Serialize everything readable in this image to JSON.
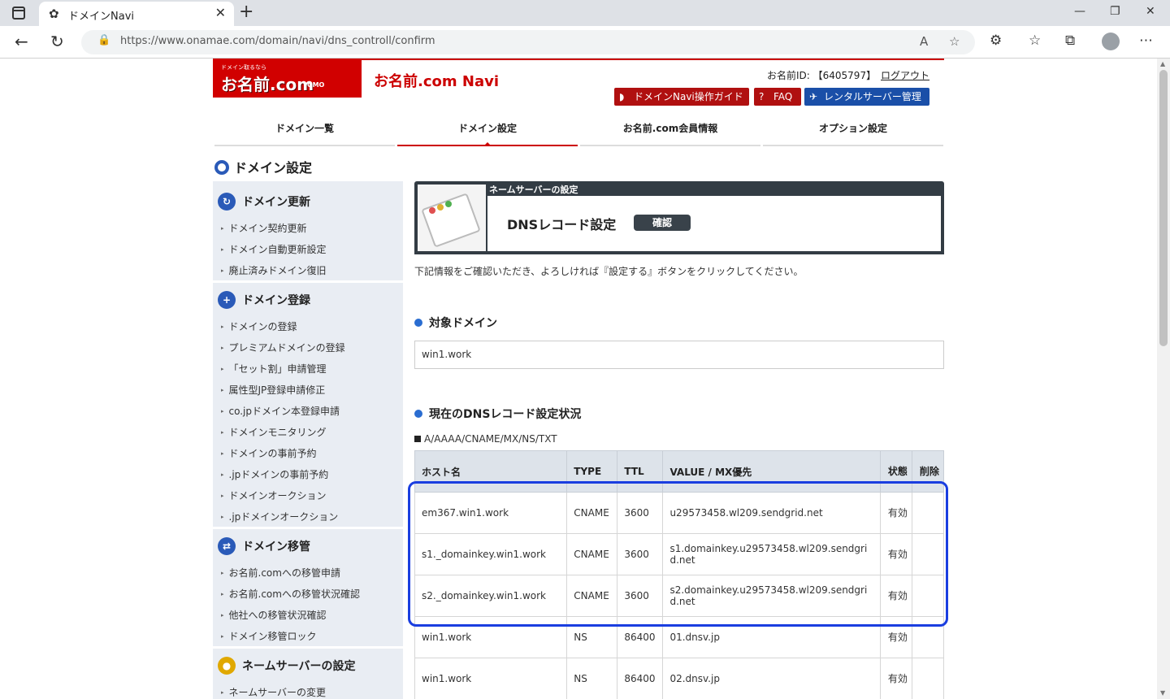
{
  "browser": {
    "tab_title": "ドメインNavi",
    "url": "https://www.onamae.com/domain/navi/dns_controll/confirm"
  },
  "header": {
    "logo_small": "ドメイン取るなら",
    "logo_main": "お名前.com",
    "logo_gmo": "GMO",
    "site_title": "お名前.com Navi",
    "user_id": "お名前ID: 【6405797】",
    "logout": "ログアウト",
    "buttons": [
      {
        "label": "ドメインNavi操作ガイド",
        "color": "#b01010"
      },
      {
        "label": "FAQ",
        "color": "#b01010"
      },
      {
        "label": "レンタルサーバー管理",
        "color": "#1a4fa8"
      }
    ]
  },
  "global_nav": [
    "ドメイン一覧",
    "ドメイン設定",
    "お名前.com会員情報",
    "オプション設定"
  ],
  "page_heading": "ドメイン設定",
  "sidebar": {
    "sections": [
      {
        "title": "ドメイン更新",
        "items": [
          "ドメイン契約更新",
          "ドメイン自動更新設定",
          "廃止済みドメイン復旧"
        ]
      },
      {
        "title": "ドメイン登録",
        "items": [
          "ドメインの登録",
          "プレミアムドメインの登録",
          "「セット割」申請管理",
          "属性型JP登録申請修正",
          "co.jpドメイン本登録申請",
          "ドメインモニタリング",
          "ドメインの事前予約",
          ".jpドメインの事前予約",
          "ドメインオークション",
          ".jpドメインオークション"
        ]
      },
      {
        "title": "ドメイン移管",
        "items": [
          "お名前.comへの移管申請",
          "お名前.comへの移管状況確認",
          "他社への移管状況確認",
          "ドメイン移管ロック"
        ]
      },
      {
        "title": "ネームサーバーの設定",
        "items": [
          "ネームサーバーの変更"
        ]
      }
    ]
  },
  "panel": {
    "label": "ネームサーバーの設定",
    "title": "DNSレコード設定",
    "badge": "確認"
  },
  "notice": "下記情報をご確認いただき、よろしければ『設定する』ボタンをクリックしてください。",
  "target_domain": {
    "heading": "対象ドメイン",
    "value": "win1.work"
  },
  "dns_status": {
    "heading": "現在のDNSレコード設定状況",
    "record_types": "A/AAAA/CNAME/MX/NS/TXT",
    "columns": [
      "ホスト名",
      "TYPE",
      "TTL",
      "VALUE / MX優先",
      "状態",
      "削除"
    ],
    "rows": [
      {
        "host": "em367.win1.work",
        "type": "CNAME",
        "ttl": "3600",
        "value": "u29573458.wl209.sendgrid.net",
        "state": "有効",
        "delete": ""
      },
      {
        "host": "s1._domainkey.win1.work",
        "type": "CNAME",
        "ttl": "3600",
        "value": "s1.domainkey.u29573458.wl209.sendgrid.net",
        "state": "有効",
        "delete": ""
      },
      {
        "host": "s2._domainkey.win1.work",
        "type": "CNAME",
        "ttl": "3600",
        "value": "s2.domainkey.u29573458.wl209.sendgrid.net",
        "state": "有効",
        "delete": ""
      },
      {
        "host": "win1.work",
        "type": "NS",
        "ttl": "86400",
        "value": "01.dnsv.jp",
        "state": "有効",
        "delete": ""
      },
      {
        "host": "win1.work",
        "type": "NS",
        "ttl": "86400",
        "value": "02.dnsv.jp",
        "state": "有効",
        "delete": ""
      }
    ]
  }
}
